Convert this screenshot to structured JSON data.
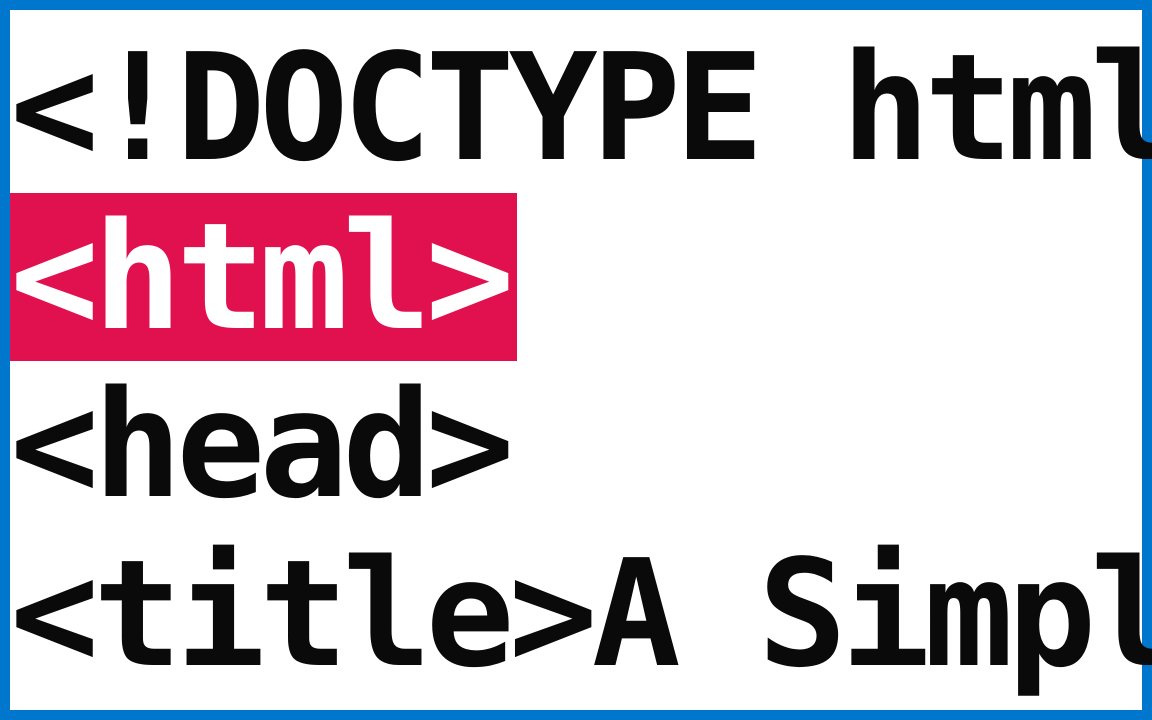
{
  "code": {
    "line1": "<!DOCTYPE html>",
    "line2": "<html>",
    "line3": "<head>",
    "line4": "<title>A Simple"
  },
  "colors": {
    "highlight_bg": "#e1114f",
    "highlight_fg": "#ffffff",
    "border": "#0077cc",
    "text": "#0a0a0a"
  }
}
